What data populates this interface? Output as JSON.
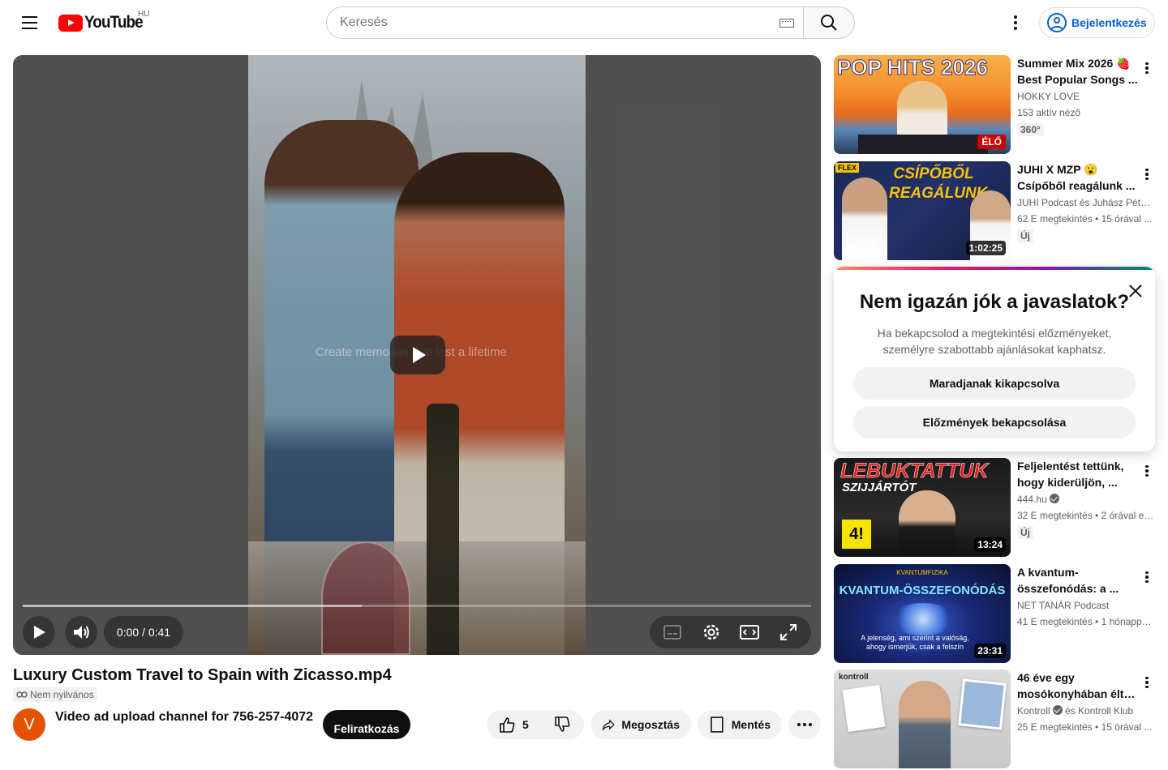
{
  "header": {
    "logo_text": "YouTube",
    "country_code": "HU",
    "search_placeholder": "Keresés",
    "signin_label": "Bejelentkezés"
  },
  "player": {
    "overlay_text": "Create memories that last a lifetime",
    "current_time": "0:00",
    "duration": "0:41",
    "time_display": "0:00 / 0:41",
    "buffered_fraction": 0.43
  },
  "video": {
    "title": "Luxury Custom Travel to Spain with Zicasso.mp4",
    "visibility": "Nem nyilvános",
    "channel_name": "Video ad upload channel for 756-257-4072",
    "channel_initial": "V",
    "subscribe_label": "Feliratkozás",
    "like_count": "5",
    "share_label": "Megosztás",
    "save_label": "Mentés"
  },
  "recommendations": [
    {
      "title_l1": "Summer Mix 2026 🍓",
      "title_l2": "Best Popular Songs ...",
      "channel": "HOKKY LOVE",
      "meta": "153 aktív néző",
      "badge": "360°",
      "thumb_text": "POP HITS 2026",
      "live_label": "ÉLŐ"
    },
    {
      "title_l1": "JUHI X MZP 😮",
      "title_l2": "Csípőből reagálunk ...",
      "channel": "JUHI Podcast és Juhász Péter...",
      "meta": "62 E megtekintés • 15 órával ...",
      "badge": "Új",
      "thumb_text": "CSÍPŐBŐL REAGÁLUNK",
      "thumb_corner": "FLEX",
      "thumb_sub": "JUHI",
      "duration": "1:02:25"
    },
    {
      "title_l1": "Feljelentést tettünk,",
      "title_l2": "hogy kiderüljön, ...",
      "channel": "444.hu",
      "meta": "32 E megtekintés • 2 órával ez...",
      "badge": "Új",
      "thumb_text": "LEBUKTATTUK",
      "thumb_sub": "SZIJJÁRTÓT",
      "thumb_logo": "4!",
      "duration": "13:24"
    },
    {
      "title_l1": "A kvantum-",
      "title_l2": "összefonódás: a ...",
      "channel": "NET TANÁR Podcast",
      "meta": "41 E megtekintés • 1 hónappa...",
      "thumb_top": "KVANTUMFIZIKA",
      "thumb_text": "KVANTUM-ÖSSZEFONÓDÁS",
      "thumb_caption": "A jelenség, ami szerint a valóság, ahogy ismerjük, csak a felszín",
      "duration": "23:31"
    },
    {
      "title_l1": "46 éve egy",
      "title_l2": "mosókonyhában élte...",
      "channel": "Kontroll",
      "channel_suffix": "és Kontroll Klub",
      "meta": "25 E megtekintés • 15 órával ...",
      "thumb_text": "kontroll"
    }
  ],
  "popup": {
    "title": "Nem igazán jók a javaslatok?",
    "body": "Ha bekapcsolod a megtekintési előzményeket, személyre szabottabb ajánlásokat kaphatsz.",
    "btn_keep_off": "Maradjanak kikapcsolva",
    "btn_turn_on": "Előzmények bekapcsolása"
  },
  "colors": {
    "brand_red": "#ff0000",
    "link_blue": "#065fd4",
    "live_red": "#cc0000"
  }
}
